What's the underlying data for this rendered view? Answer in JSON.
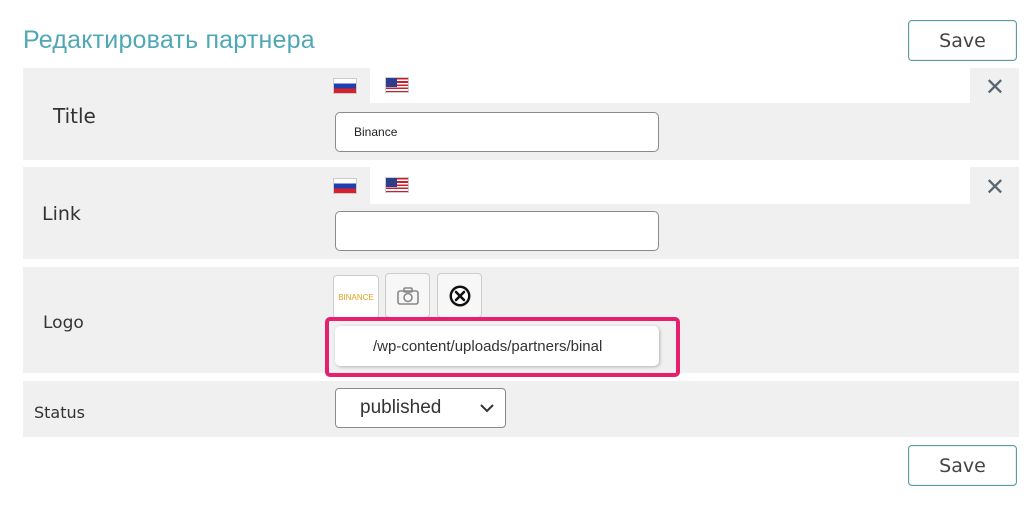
{
  "page_title": "Редактировать партнера",
  "save_label": "Save",
  "fields": {
    "title": {
      "label": "Title",
      "value": "Binance"
    },
    "link": {
      "label": "Link",
      "value": ""
    },
    "logo": {
      "label": "Logo",
      "thumb_text": "BINANCE",
      "path": "/wp-content/uploads/partners/binal"
    },
    "status": {
      "label": "Status",
      "value": "published"
    }
  },
  "languages": [
    "ru-flag",
    "us-flag"
  ],
  "icons": {
    "close": "close-icon",
    "camera": "camera-icon",
    "remove": "remove-circle-icon",
    "chevron": "chevron-down-icon"
  },
  "colors": {
    "title": "#4fa8b4",
    "highlight": "#e6206e",
    "row_bg": "#f0f0f0"
  }
}
